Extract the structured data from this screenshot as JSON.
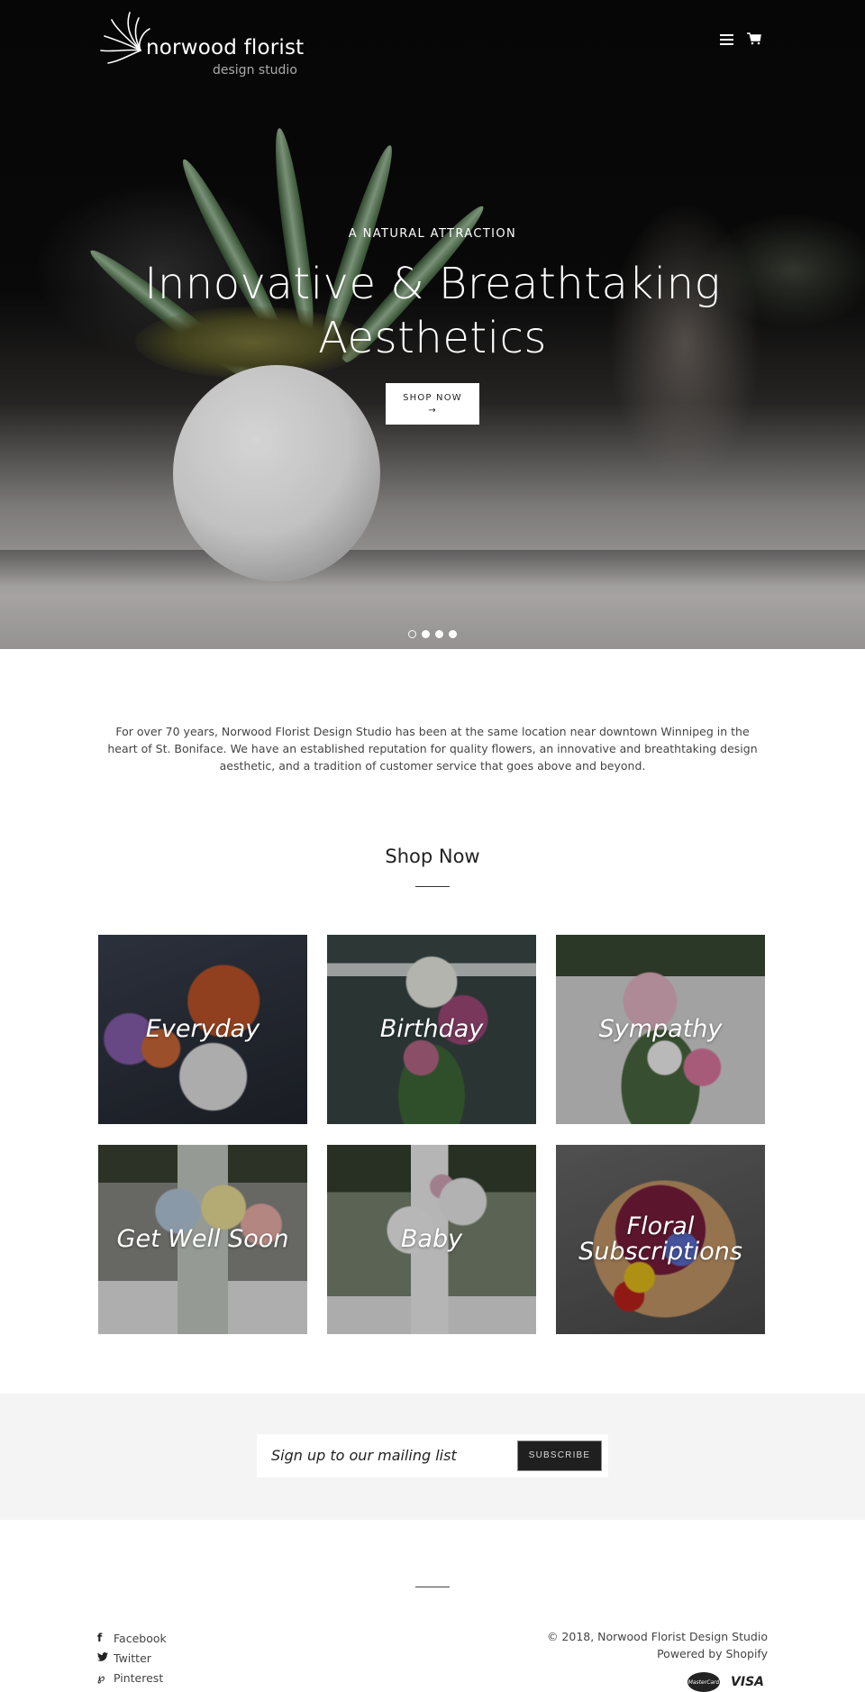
{
  "header": {
    "logo_name": "norwood florist",
    "logo_sub": "design studio",
    "menu_icon": "hamburger-menu-icon",
    "cart_icon": "shopping-cart-icon"
  },
  "hero": {
    "kicker": "A NATURAL ATTRACTION",
    "title_line1": "Innovative & Breathtaking",
    "title_line2": "Aesthetics",
    "button_label": "SHOP NOW",
    "button_arrow": "→",
    "slides": [
      {
        "active": true
      },
      {
        "active": false
      },
      {
        "active": false
      },
      {
        "active": false
      }
    ]
  },
  "intro": {
    "text": "For over 70 years, Norwood Florist Design Studio has been at the same location near downtown Winnipeg in the heart of St. Boniface. We have an established reputation for quality flowers, an innovative and breathtaking design aesthetic, and a tradition of customer service that goes above and beyond."
  },
  "shop": {
    "title": "Shop Now",
    "collections": [
      {
        "label": "Everyday"
      },
      {
        "label": "Birthday"
      },
      {
        "label": "Sympathy"
      },
      {
        "label": "Get Well Soon"
      },
      {
        "label": "Baby"
      },
      {
        "label": "Floral Subscriptions"
      }
    ]
  },
  "newsletter": {
    "placeholder": "Sign up to our mailing list",
    "button_label": "SUBSCRIBE"
  },
  "footer": {
    "social": [
      {
        "icon": "facebook-icon",
        "glyph": "f",
        "label": "Facebook"
      },
      {
        "icon": "twitter-icon",
        "glyph": "🐦",
        "label": "Twitter"
      },
      {
        "icon": "pinterest-icon",
        "glyph": "℘",
        "label": "Pinterest"
      }
    ],
    "copyright": "© 2018, Norwood Florist Design Studio",
    "powered_by": "Powered by Shopify",
    "payments": {
      "mastercard": "MasterCard",
      "visa": "VISA"
    }
  }
}
